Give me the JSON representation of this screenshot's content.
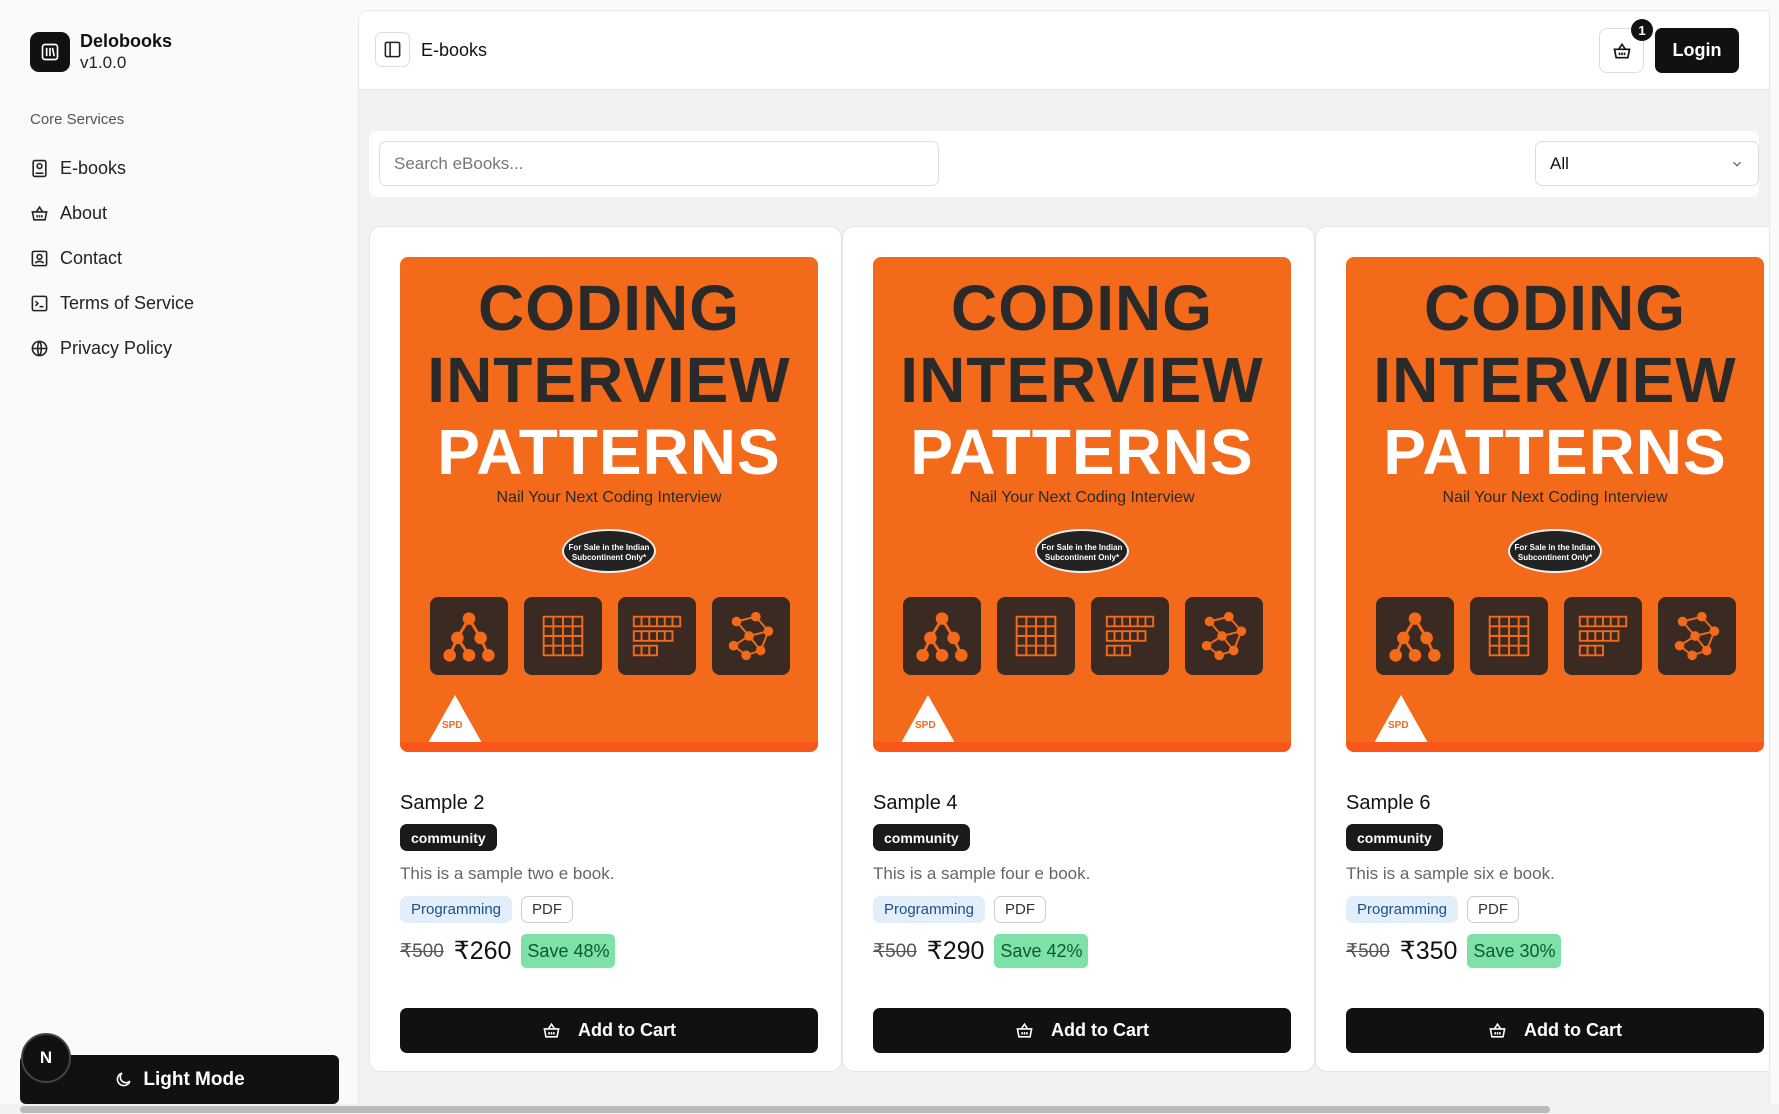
{
  "brand": {
    "name": "Delobooks",
    "version": "v1.0.0"
  },
  "sidebar": {
    "section_label": "Core Services",
    "items": [
      {
        "label": "E-books",
        "icon": "book-icon"
      },
      {
        "label": "About",
        "icon": "basket-icon"
      },
      {
        "label": "Contact",
        "icon": "contact-icon"
      },
      {
        "label": "Terms of Service",
        "icon": "terms-icon"
      },
      {
        "label": "Privacy Policy",
        "icon": "globe-icon"
      }
    ],
    "theme_button": "Light Mode",
    "avatar_letter": "N"
  },
  "header": {
    "title": "E-books",
    "cart_count": "1",
    "login_label": "Login"
  },
  "filters": {
    "search_placeholder": "Search eBooks...",
    "category_selected": "All"
  },
  "cover": {
    "line1": "CODING",
    "line2": "INTERVIEW",
    "line3": "PATTERNS",
    "subtitle": "Nail Your Next Coding Interview",
    "seal_line1": "For Sale in the Indian",
    "seal_line2": "Subcontinent Only*",
    "publisher": "SPD"
  },
  "books": [
    {
      "title": "Sample 2",
      "badge": "community",
      "description": "This is a sample two e book.",
      "category": "Programming",
      "format": "PDF",
      "original_price": "₹500",
      "price": "₹260",
      "save": "Save 48%",
      "cta": "Add to Cart"
    },
    {
      "title": "Sample 4",
      "badge": "community",
      "description": "This is a sample four e book.",
      "category": "Programming",
      "format": "PDF",
      "original_price": "₹500",
      "price": "₹290",
      "save": "Save 42%",
      "cta": "Add to Cart"
    },
    {
      "title": "Sample 6",
      "badge": "community",
      "description": "This is a sample six e book.",
      "category": "Programming",
      "format": "PDF",
      "original_price": "₹500",
      "price": "₹350",
      "save": "Save 30%",
      "cta": "Add to Cart"
    }
  ],
  "colors": {
    "accent": "#111111",
    "cover": "#f26a1a",
    "save_badge": "#7ee2a8",
    "category_chip": "#e3eefb"
  }
}
